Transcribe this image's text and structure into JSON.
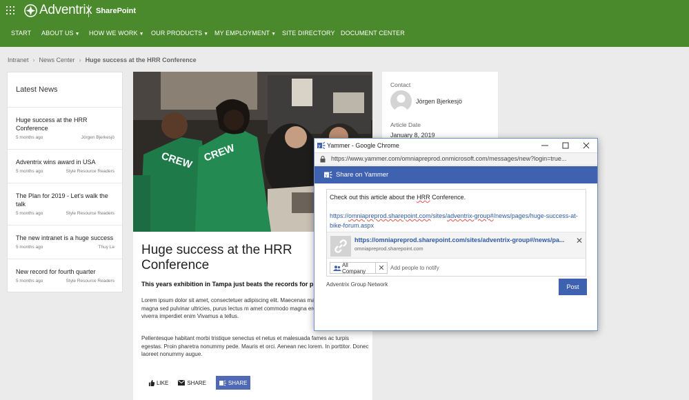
{
  "suite": {
    "brand": "Adventrix",
    "app": "SharePoint"
  },
  "nav": [
    {
      "label": "START",
      "caret": false
    },
    {
      "label": "ABOUT US",
      "caret": true
    },
    {
      "label": "HOW WE WORK",
      "caret": true
    },
    {
      "label": "OUR PRODUCTS",
      "caret": true
    },
    {
      "label": "MY EMPLOYMENT",
      "caret": true
    },
    {
      "label": "SITE DIRECTORY",
      "caret": false
    },
    {
      "label": "DOCUMENT CENTER",
      "caret": false
    }
  ],
  "breadcrumb": {
    "root": "Intranet",
    "section": "News Center",
    "current": "Huge success at the HRR Conference"
  },
  "latest_news": {
    "title": "Latest News",
    "items": [
      {
        "title": "Huge success at the HRR Conference",
        "time": "5 months ago",
        "author": "Jörgen Bjerkesjö"
      },
      {
        "title": "Adventrix wins award in USA",
        "time": "5 months ago",
        "author": "Style Resource Readers"
      },
      {
        "title": "The Plan for 2019 - Let's walk the talk",
        "time": "5 months ago",
        "author": "Style Resource Readers"
      },
      {
        "title": "The new intranet is a huge success",
        "time": "5 months ago",
        "author": "Thuy Le"
      },
      {
        "title": "New record for fourth quarter",
        "time": "5 months ago",
        "author": "Style Resource Readers"
      }
    ]
  },
  "article": {
    "title": "Huge success at the HRR Conference",
    "lead": "This years exhibition in Tampa just beats the records for p",
    "para1": "Lorem ipsum dolor sit amet, consectetuer adipiscing elit. Maecenas massa. Fusce posuere, magna sed pulvinar ultricies, purus lectus m amet commodo magna eros quis urna. Nunc viverra imperdiet enim Vivamus a tellus.",
    "para2": "Pellentesque habitant morbi tristique senectus et netus et malesuada fames ac turpis egestas. Proin pharetra nonummy pede. Mauris et orci. Aenean nec lorem. In porttitor. Donec laoreet nonummy augue.",
    "shirt_text": "CREW",
    "actions": {
      "like": "LIKE",
      "share": "SHARE",
      "share_yammer": "SHARE"
    }
  },
  "contact": {
    "label": "Contact",
    "name": "Jörgen Bjerkesjö",
    "date_label": "Article Date",
    "date": "January 8, 2019"
  },
  "popup": {
    "window_title": "Yammer - Google Chrome",
    "url": "https://www.yammer.com/omniapreprod.onmicrosoft.com/messages/new?login=true...",
    "header": "Share on Yammer",
    "message_before": "Check out this article about the ",
    "message_hrr": "HRR",
    "message_after": " Conference.",
    "link_1": "https://",
    "link_2": "omniapreprod.sharepoint.com",
    "link_3": "/sites/",
    "link_4": "adventrix-group#",
    "link_5": "/news/pages/huge-success-at-bike-forum.aspx",
    "preview_url": "https://omniapreprod.sharepoint.com/sites/adventrix-group#/news/pa...",
    "preview_domain": "omniapreprod.sharepoint.com",
    "group": "All Company",
    "notify_placeholder": "Add people to notify",
    "network": "Adventrix Group Network",
    "post": "Post"
  }
}
